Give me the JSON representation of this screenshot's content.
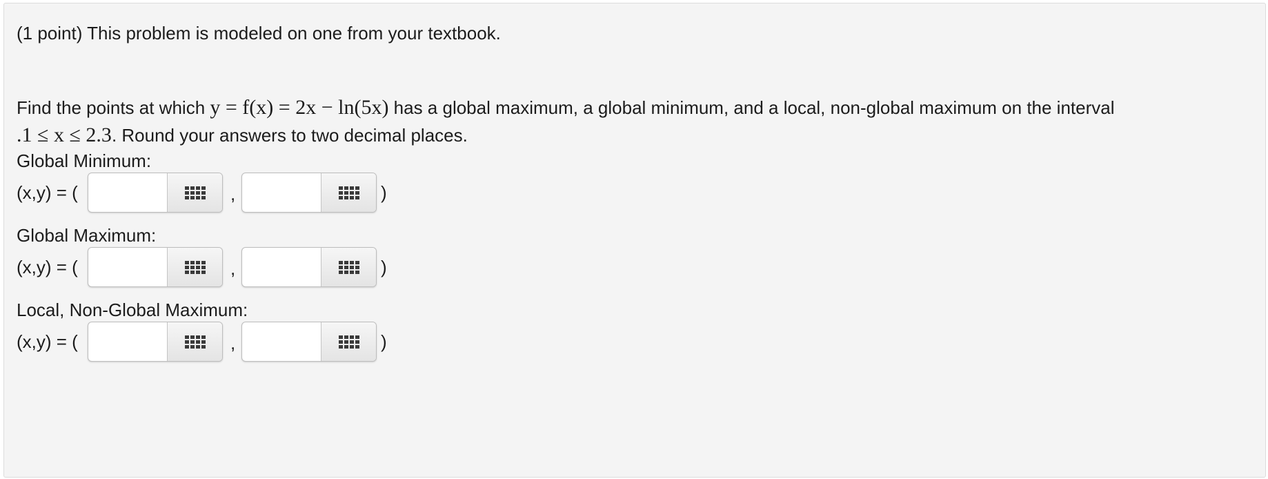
{
  "problem": {
    "header": "(1 point) This problem is modeled on one from your textbook.",
    "statement_pre": "Find the points at which ",
    "function_math": "y = f(x) = 2x − ln(5x)",
    "statement_mid": " has a global maximum, a global minimum, and a local, non-global maximum on the interval",
    "interval_math": ".1 ≤ x ≤ 2.3",
    "statement_post": ". Round your answers to two decimal places."
  },
  "sections": [
    {
      "label": "Global Minimum:",
      "prefix": "(x,y) = (",
      "separator": ",",
      "suffix": ")",
      "x_value": "",
      "y_value": ""
    },
    {
      "label": "Global Maximum:",
      "prefix": "(x,y) = (",
      "separator": ",",
      "suffix": ")",
      "x_value": "",
      "y_value": ""
    },
    {
      "label": "Local, Non-Global Maximum:",
      "prefix": "(x,y) = (",
      "separator": ",",
      "suffix": ")",
      "x_value": "",
      "y_value": ""
    }
  ],
  "icons": {
    "palette_button": "grid-keypad-icon"
  },
  "colors": {
    "panel_background": "#f4f4f4",
    "panel_border": "#dcdcdc",
    "text": "#1c1c1c",
    "input_border": "#bdbdbd"
  }
}
